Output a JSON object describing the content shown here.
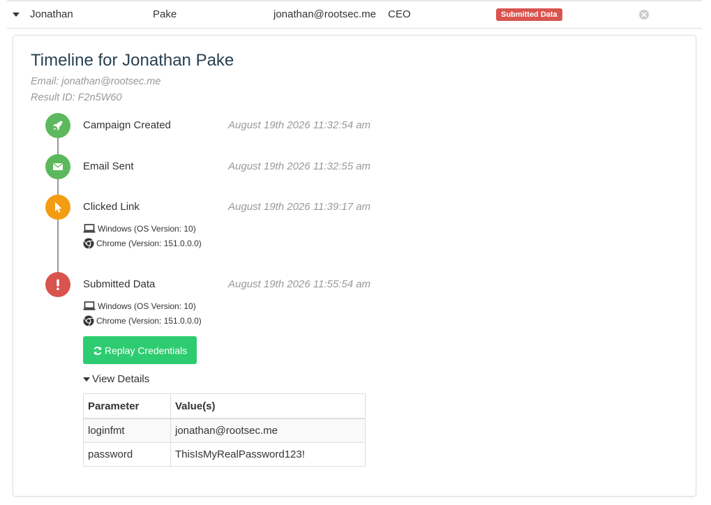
{
  "row": {
    "first_name": "Jonathan",
    "last_name": "Pake",
    "email": "jonathan@rootsec.me",
    "position": "CEO",
    "status": "Submitted Data"
  },
  "timeline": {
    "title": "Timeline for Jonathan Pake",
    "email": "Email: jonathan@rootsec.me",
    "result_id": "Result ID: F2n5W60",
    "events": [
      {
        "label": "Campaign Created",
        "time": "August 19th 2026 11:32:54 am",
        "icon": "rocket-icon",
        "color": "#5cb85c"
      },
      {
        "label": "Email Sent",
        "time": "August 19th 2026 11:32:55 am",
        "icon": "envelope-icon",
        "color": "#5cb85c"
      },
      {
        "label": "Clicked Link",
        "time": "August 19th 2026 11:39:17 am",
        "icon": "mouse-pointer-icon",
        "color": "#f39c12",
        "os": "Windows (OS Version: 10)",
        "browser": "Chrome (Version: 151.0.0.0)"
      },
      {
        "label": "Submitted Data",
        "time": "August 19th 2026 11:55:54 am",
        "icon": "exclamation-icon",
        "color": "#d9534f",
        "os": "Windows (OS Version: 10)",
        "browser": "Chrome (Version: 151.0.0.0)"
      }
    ],
    "replay_label": "Replay Credentials",
    "view_details_label": "View Details",
    "details_table": {
      "headers": [
        "Parameter",
        "Value(s)"
      ],
      "rows": [
        [
          "loginfmt",
          "jonathan@rootsec.me"
        ],
        [
          "password",
          "ThisIsMyRealPassword123!"
        ]
      ]
    }
  },
  "colors": {
    "badge_submitted": "#d9534f",
    "replay_button": "#2ecc71",
    "title": "#283f50"
  }
}
